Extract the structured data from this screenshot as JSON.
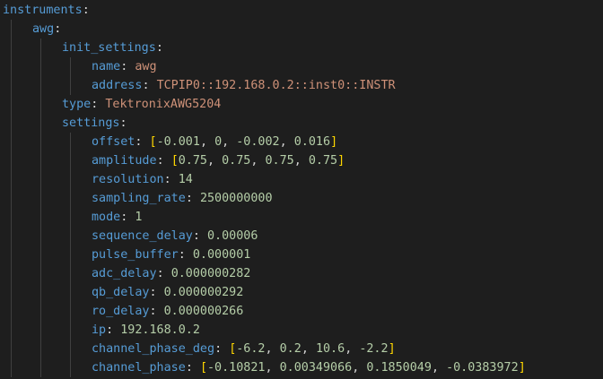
{
  "editor": {
    "language": "yaml",
    "colors": {
      "background": "#1e1e1e",
      "key": "#569cd6",
      "string": "#ce9178",
      "number": "#b5cea8",
      "punctuation": "#d4d4d4",
      "bracket": "#ffd700",
      "indent_guide": "#404040"
    },
    "lines": [
      {
        "indent": 0,
        "key": "instruments",
        "value": null
      },
      {
        "indent": 1,
        "key": "awg",
        "value": null
      },
      {
        "indent": 2,
        "key": "init_settings",
        "value": null
      },
      {
        "indent": 3,
        "key": "name",
        "value": "awg",
        "vtype": "string"
      },
      {
        "indent": 3,
        "key": "address",
        "value": "TCPIP0::192.168.0.2::inst0::INSTR",
        "vtype": "string"
      },
      {
        "indent": 2,
        "key": "type",
        "value": "TektronixAWG5204",
        "vtype": "string"
      },
      {
        "indent": 2,
        "key": "settings",
        "value": null
      },
      {
        "indent": 3,
        "key": "offset",
        "vtype": "list",
        "items": [
          "-0.001",
          "0",
          "-0.002",
          "0.016"
        ]
      },
      {
        "indent": 3,
        "key": "amplitude",
        "vtype": "list",
        "items": [
          "0.75",
          "0.75",
          "0.75",
          "0.75"
        ]
      },
      {
        "indent": 3,
        "key": "resolution",
        "value": "14",
        "vtype": "number"
      },
      {
        "indent": 3,
        "key": "sampling_rate",
        "value": "2500000000",
        "vtype": "number"
      },
      {
        "indent": 3,
        "key": "mode",
        "value": "1",
        "vtype": "number"
      },
      {
        "indent": 3,
        "key": "sequence_delay",
        "value": "0.00006",
        "vtype": "number"
      },
      {
        "indent": 3,
        "key": "pulse_buffer",
        "value": "0.000001",
        "vtype": "number"
      },
      {
        "indent": 3,
        "key": "adc_delay",
        "value": "0.000000282",
        "vtype": "number"
      },
      {
        "indent": 3,
        "key": "qb_delay",
        "value": "0.000000292",
        "vtype": "number"
      },
      {
        "indent": 3,
        "key": "ro_delay",
        "value": "0.000000266",
        "vtype": "number"
      },
      {
        "indent": 3,
        "key": "ip",
        "value": "192.168.0.2",
        "vtype": "number"
      },
      {
        "indent": 3,
        "key": "channel_phase_deg",
        "vtype": "list",
        "items": [
          "-6.2",
          "0.2",
          "10.6",
          "-2.2"
        ]
      },
      {
        "indent": 3,
        "key": "channel_phase",
        "vtype": "list",
        "items": [
          "-0.10821",
          "0.00349066",
          "0.1850049",
          "-0.0383972"
        ]
      }
    ]
  }
}
